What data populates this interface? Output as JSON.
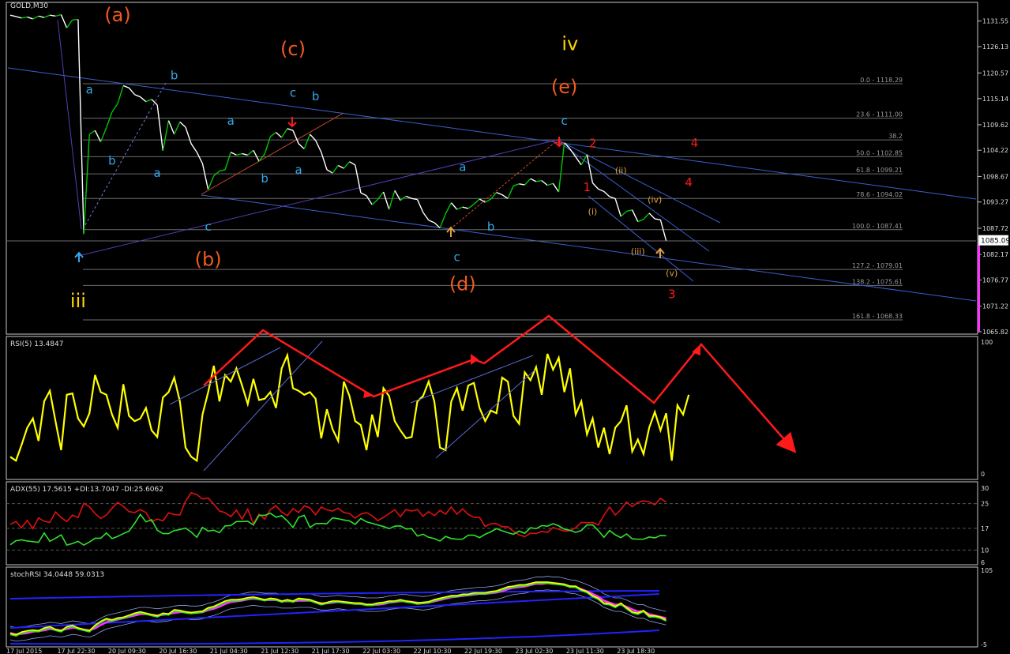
{
  "symbol": "GOLD,M30",
  "colors": {
    "background": "#000000",
    "frame": "#c8c8c8",
    "price_up": "#00c800",
    "price_down": "#ffffff",
    "trendline": "#3a5ecf",
    "fib_line": "#6b6b6b",
    "wave_blue": "#35a7e8",
    "wave_orange": "#f05a1e",
    "wave_yellow": "#ffd400",
    "wave_red": "#ff1a1a",
    "wave_tan": "#e0a040",
    "rsi_line": "#ffff00",
    "adx_red": "#e01010",
    "adx_green": "#30e030",
    "projection": "#ff1a1a"
  },
  "price_axis": {
    "min": 1065.82,
    "max": 1134.5,
    "ticks": [
      "1131.55",
      "1126.13",
      "1120.57",
      "1115.14",
      "1109.62",
      "1104.22",
      "1098.67",
      "1093.27",
      "1087.72",
      "1082.17",
      "1076.77",
      "1071.22",
      "1065.82"
    ],
    "current_price": "1085.09",
    "current_price_value": 1085.09
  },
  "fib_levels": [
    {
      "label": "0.0 - 1118.29",
      "price": 1118.29
    },
    {
      "label": "23.6 - 1111.00",
      "price": 1111.0
    },
    {
      "label": "38.2",
      "price": 1106.4
    },
    {
      "label": "50.0 - 1102.85",
      "price": 1102.85
    },
    {
      "label": "61.8 - 1099.21",
      "price": 1099.21
    },
    {
      "label": "78.6 - 1094.02",
      "price": 1094.02
    },
    {
      "label": "100.0 - 1087.41",
      "price": 1087.41
    },
    {
      "label": "127.2 - 1079.01",
      "price": 1079.01
    },
    {
      "label": "138.2 - 1075.61",
      "price": 1075.61
    },
    {
      "label": "161.8 - 1068.33",
      "price": 1068.33
    }
  ],
  "wave_labels": [
    {
      "text": "(a)",
      "color": "wave_orange",
      "size": "large",
      "bar": 19,
      "price": 1131.5
    },
    {
      "text": "a",
      "color": "wave_blue",
      "size": "small",
      "bar": 14,
      "price": 1116.2
    },
    {
      "text": "b",
      "color": "wave_blue",
      "size": "small",
      "bar": 29,
      "price": 1119.2
    },
    {
      "text": "b",
      "color": "wave_blue",
      "size": "small",
      "bar": 18,
      "price": 1101.2
    },
    {
      "text": "a",
      "color": "wave_blue",
      "size": "small",
      "bar": 26,
      "price": 1098.6
    },
    {
      "text": "(c)",
      "color": "wave_orange",
      "size": "large",
      "bar": 50,
      "price": 1124.3
    },
    {
      "text": "c",
      "color": "wave_blue",
      "size": "small",
      "bar": 50,
      "price": 1115.5
    },
    {
      "text": "b",
      "color": "wave_blue",
      "size": "small",
      "bar": 54,
      "price": 1114.8
    },
    {
      "text": "a",
      "color": "wave_blue",
      "size": "small",
      "bar": 39,
      "price": 1109.6
    },
    {
      "text": "a",
      "color": "wave_blue",
      "size": "small",
      "bar": 51,
      "price": 1099.2
    },
    {
      "text": "b",
      "color": "wave_blue",
      "size": "small",
      "bar": 45,
      "price": 1097.4
    },
    {
      "text": "c",
      "color": "wave_blue",
      "size": "small",
      "bar": 35,
      "price": 1087.2
    },
    {
      "text": "(b)",
      "color": "wave_orange",
      "size": "large",
      "bar": 35,
      "price": 1079.8
    },
    {
      "text": "iii",
      "color": "wave_yellow",
      "size": "large",
      "bar": 12,
      "price": 1071.0
    },
    {
      "text": "a",
      "color": "wave_blue",
      "size": "small",
      "bar": 80,
      "price": 1099.8
    },
    {
      "text": "b",
      "color": "wave_blue",
      "size": "small",
      "bar": 85,
      "price": 1087.2
    },
    {
      "text": "c",
      "color": "wave_blue",
      "size": "small",
      "bar": 79,
      "price": 1080.8
    },
    {
      "text": "(d)",
      "color": "wave_orange",
      "size": "large",
      "bar": 80,
      "price": 1074.6
    },
    {
      "text": "iv",
      "color": "wave_yellow",
      "size": "large",
      "bar": 99,
      "price": 1125.4
    },
    {
      "text": "(e)",
      "color": "wave_orange",
      "size": "large",
      "bar": 98,
      "price": 1116.3
    },
    {
      "text": "c",
      "color": "wave_blue",
      "size": "small",
      "bar": 98,
      "price": 1109.6
    },
    {
      "text": "2",
      "color": "wave_red",
      "size": "small",
      "bar": 103,
      "price": 1104.8
    },
    {
      "text": "1",
      "color": "wave_red",
      "size": "small",
      "bar": 102,
      "price": 1095.6
    },
    {
      "text": "(ii)",
      "color": "wave_tan",
      "size": "tiny",
      "bar": 108,
      "price": 1099.3
    },
    {
      "text": "(i)",
      "color": "wave_tan",
      "size": "tiny",
      "bar": 103,
      "price": 1090.6
    },
    {
      "text": "(iv)",
      "color": "wave_tan",
      "size": "tiny",
      "bar": 114,
      "price": 1093.1
    },
    {
      "text": "(iii)",
      "color": "wave_tan",
      "size": "tiny",
      "bar": 111,
      "price": 1082.2
    },
    {
      "text": "(v)",
      "color": "wave_tan",
      "size": "tiny",
      "bar": 117,
      "price": 1077.6
    },
    {
      "text": "3",
      "color": "wave_red",
      "size": "small",
      "bar": 117,
      "price": 1072.9
    },
    {
      "text": "4",
      "color": "wave_red",
      "size": "small",
      "bar": 121,
      "price": 1104.9
    },
    {
      "text": "4",
      "color": "wave_red",
      "size": "small",
      "bar": 120,
      "price": 1096.6
    }
  ],
  "rsi": {
    "label": "RSI(5) 13.4847",
    "ticks": [
      "100",
      "0"
    ],
    "min": 0,
    "max": 100
  },
  "adx": {
    "label": "ADX(55) 17.5615 +DI:13.7047 -DI:25.6062",
    "ticks": [
      "30",
      "25",
      "17",
      "10",
      "6"
    ],
    "levels": [
      25,
      17,
      10
    ],
    "min": 6,
    "max": 30
  },
  "stochrsi": {
    "label": "stochRSI 34.0448 59.0313",
    "ticks": [
      "105",
      "-5"
    ],
    "min": -5,
    "max": 105
  },
  "time_axis": {
    "labels": [
      "17 Jul 2015",
      "17 Jul 22:30",
      "20 Jul 09:30",
      "20 Jul 16:30",
      "21 Jul 04:30",
      "21 Jul 12:30",
      "21 Jul 17:30",
      "22 Jul 03:30",
      "22 Jul 10:30",
      "22 Jul 19:30",
      "23 Jul 02:30",
      "23 Jul 11:30",
      "23 Jul 18:30"
    ],
    "label_bars": [
      0,
      9,
      18,
      27,
      36,
      45,
      54,
      63,
      72,
      81,
      90,
      99,
      108
    ]
  },
  "chart_data": {
    "type": "line",
    "title": "GOLD,M30",
    "x": [
      0,
      1,
      2,
      3,
      4,
      5,
      6,
      7,
      8,
      9,
      10,
      11,
      12,
      13,
      14,
      15,
      16,
      17,
      18,
      19,
      20,
      21,
      22,
      23,
      24,
      25,
      26,
      27,
      28,
      29,
      30,
      31,
      32,
      33,
      34,
      35,
      36,
      37,
      38,
      39,
      40,
      41,
      42,
      43,
      44,
      45,
      46,
      47,
      48,
      49,
      50,
      51,
      52,
      53,
      54,
      55,
      56,
      57,
      58,
      59,
      60,
      61,
      62,
      63,
      64,
      65,
      66,
      67,
      68,
      69,
      70,
      71,
      72,
      73,
      74,
      75,
      76,
      77,
      78,
      79,
      80,
      81,
      82,
      83,
      84,
      85,
      86,
      87,
      88,
      89,
      90,
      91,
      92,
      93,
      94,
      95,
      96,
      97,
      98,
      99,
      100,
      101,
      102,
      103,
      104,
      105,
      106,
      107,
      108,
      109,
      110,
      111,
      112,
      113,
      114,
      115,
      116
    ],
    "series": [
      {
        "values": [
          1132.8,
          1132.5,
          1132.2,
          1132.4,
          1132.0,
          1132.6,
          1132.3,
          1132.8,
          1132.6,
          1132.9,
          1130.1,
          1131.8,
          1131.9,
          1086.5,
          1107.6,
          1108.4,
          1106.0,
          1109.0,
          1112.3,
          1114.1,
          1117.9,
          1117.4,
          1116.0,
          1115.5,
          1114.5,
          1115.0,
          1113.8,
          1104.1,
          1110.5,
          1107.6,
          1110.2,
          1109.1,
          1105.6,
          1103.8,
          1101.4,
          1095.9,
          1098.8,
          1099.8,
          1100.1,
          1103.8,
          1103.2,
          1103.5,
          1103.2,
          1104.2,
          1101.9,
          1103.4,
          1107.1,
          1108.0,
          1106.9,
          1108.8,
          1108.4,
          1105.6,
          1104.5,
          1107.6,
          1106.3,
          1103.8,
          1100.1,
          1099.4,
          1101.0,
          1100.4,
          1101.8,
          1101.1,
          1095.2,
          1094.6,
          1092.7,
          1093.8,
          1095.4,
          1091.7,
          1095.7,
          1093.6,
          1094.5,
          1094.0,
          1093.8,
          1091.1,
          1089.4,
          1088.9,
          1087.8,
          1090.8,
          1093.1,
          1091.7,
          1092.2,
          1091.9,
          1092.8,
          1093.9,
          1093.2,
          1093.9,
          1095.3,
          1094.8,
          1094.0,
          1096.7,
          1097.1,
          1096.9,
          1098.2,
          1097.6,
          1097.8,
          1096.8,
          1097.2,
          1095.4,
          1105.8,
          1104.5,
          1102.8,
          1101.1,
          1103.3,
          1097.3,
          1096.0,
          1095.5,
          1094.4,
          1094.0,
          1090.2,
          1091.3,
          1091.6,
          1089.1,
          1089.6,
          1090.9,
          1089.7,
          1089.5,
          1085.1
        ]
      }
    ],
    "rsi_values": [
      13,
      10,
      22,
      35,
      42,
      25,
      55,
      63,
      40,
      18,
      60,
      61,
      42,
      36,
      46,
      75,
      62,
      60,
      45,
      35,
      68,
      44,
      40,
      42,
      50,
      33,
      28,
      58,
      62,
      73,
      55,
      20,
      13,
      10,
      45,
      62,
      82,
      55,
      75,
      70,
      80,
      67,
      53,
      72,
      56,
      57,
      62,
      50,
      80,
      90,
      65,
      63,
      60,
      62,
      57,
      27,
      49,
      34,
      25,
      70,
      59,
      40,
      37,
      18,
      45,
      28,
      65,
      59,
      40,
      33,
      27,
      28,
      55,
      59,
      70,
      55,
      20,
      18,
      55,
      65,
      48,
      67,
      69,
      50,
      40,
      48,
      46,
      73,
      70,
      44,
      38,
      77,
      71,
      81,
      60,
      91,
      79,
      88,
      62,
      80,
      45,
      55,
      30,
      42,
      20,
      35,
      15,
      35,
      40,
      52,
      17,
      26,
      15,
      35,
      47,
      33,
      46,
      10,
      52,
      45,
      60
    ],
    "adx_values": [
      18.3,
      19.2,
      17.2,
      19.6,
      16.9,
      20.4,
      19.3,
      18.9,
      22.3,
      20.5,
      19.2,
      21.3,
      20.5,
      25.1,
      24.0,
      21.8,
      20.2,
      21.3,
      23.5,
      25.4,
      24.1,
      22.4,
      22.1,
      23.1,
      22.1,
      19.1,
      20.0,
      19.4,
      22.0,
      21.5,
      21.3,
      25.8,
      28.5,
      27.9,
      26.5,
      26.8,
      24.8,
      22.6,
      22.1,
      20.8,
      22.9,
      20.0,
      23.2,
      18.5,
      21.6,
      20.0,
      23.1,
      24.3,
      22.3,
      21.1,
      23.4,
      22.1,
      24.3,
      23.6,
      21.4,
      23.9,
      23.0,
      22.6,
      23.5,
      22.1,
      21.8,
      20.3,
      21.6,
      22.1,
      21.1,
      19.5,
      20.5,
      21.8,
      23.0,
      20.8,
      23.1,
      22.6,
      23.1,
      20.9,
      22.4,
      21.1,
      22.8,
      21.6,
      23.9,
      21.6,
      23.3,
      21.5,
      20.6,
      20.5,
      17.6,
      18.5,
      18.5,
      17.5,
      17.5,
      16.0,
      14.9,
      14.3,
      15.5,
      15.3,
      16.0,
      15.7,
      17.3,
      16.7,
      16.1,
      16.2,
      17.2,
      18.9,
      18.8,
      18.9,
      18.1,
      21.2,
      23.9,
      21.3,
      23.1,
      25.5,
      24.0,
      25.4,
      25.9,
      25.6,
      24.6,
      26.7,
      25.5
    ],
    "di_values": [
      11.7,
      13.0,
      13.3,
      12.9,
      12.7,
      12.5,
      15.5,
      12.8,
      13.8,
      14.9,
      11.6,
      12.1,
      12.8,
      11.6,
      12.6,
      13.8,
      13.8,
      15.5,
      13.7,
      14.4,
      15.3,
      16.1,
      18.6,
      21.5,
      19.1,
      19.8,
      16.4,
      15.3,
      15.3,
      16.3,
      16.6,
      17.1,
      15.8,
      14.1,
      17.3,
      16.1,
      16.4,
      15.6,
      17.8,
      17.9,
      19.2,
      19.2,
      19.3,
      18.1,
      21.2,
      21.2,
      21.9,
      20.6,
      21.1,
      19.4,
      17.3,
      20.6,
      21.2,
      17.3,
      18.5,
      18.6,
      18.5,
      20.4,
      20.1,
      19.7,
      19.4,
      18.3,
      20.2,
      19.1,
      18.6,
      18.1,
      17.6,
      16.9,
      17.7,
      17.8,
      16.8,
      16.9,
      14.5,
      15.1,
      14.1,
      13.7,
      12.9,
      14.4,
      13.7,
      13.5,
      13.5,
      14.8,
      14.8,
      14.0,
      15.1,
      15.9,
      16.9,
      16.2,
      15.6,
      15.1,
      16.1,
      15.4,
      17.2,
      16.9,
      17.9,
      17.7,
      18.5,
      17.8,
      16.7,
      16.4,
      15.7,
      16.3,
      18.1,
      18.1,
      16.3,
      14.1,
      16.3,
      14.9,
      14.0,
      15.2,
      13.6,
      13.5,
      13.5,
      14.2,
      13.9,
      14.7,
      14.6
    ],
    "stoch_k": [
      10,
      8,
      12,
      14,
      15,
      14,
      18,
      20,
      16,
      14,
      20,
      22,
      18,
      16,
      14,
      22,
      28,
      32,
      30,
      33,
      34,
      37,
      40,
      42,
      40,
      38,
      36,
      40,
      39,
      45,
      44,
      42,
      41,
      42,
      43,
      48,
      50,
      54,
      58,
      60,
      60,
      61,
      63,
      64,
      62,
      60,
      62,
      61,
      58,
      60,
      58,
      62,
      61,
      60,
      57,
      54,
      56,
      58,
      58,
      57,
      56,
      55,
      55,
      53,
      53,
      55,
      56,
      58,
      58,
      60,
      58,
      57,
      55,
      56,
      57,
      60,
      62,
      64,
      66,
      66,
      68,
      68,
      70,
      70,
      70,
      72,
      73,
      76,
      79,
      80,
      82,
      82,
      84,
      86,
      86,
      86,
      85,
      84,
      83,
      80,
      80,
      75,
      72,
      66,
      62,
      55,
      54,
      50,
      55,
      48,
      42,
      40,
      44,
      36,
      36,
      34,
      30
    ],
    "stoch_d": [
      12,
      10,
      11,
      12,
      14,
      15,
      16,
      18,
      17,
      16,
      18,
      20,
      19,
      17,
      16,
      19,
      24,
      28,
      30,
      32,
      34,
      36,
      38,
      40,
      40,
      39,
      38,
      39,
      40,
      42,
      43,
      43,
      42,
      42,
      43,
      46,
      48,
      51,
      55,
      58,
      59,
      60,
      62,
      63,
      62,
      61,
      61,
      61,
      59,
      59,
      59,
      60,
      60,
      60,
      58,
      56,
      56,
      57,
      58,
      57,
      56,
      56,
      55,
      54,
      54,
      54,
      55,
      57,
      58,
      59,
      59,
      58,
      57,
      56,
      57,
      59,
      61,
      63,
      65,
      66,
      67,
      68,
      69,
      70,
      70,
      71,
      72,
      74,
      77,
      79,
      80,
      81,
      83,
      85,
      85,
      86,
      85,
      85,
      83,
      81,
      80,
      77,
      74,
      70,
      66,
      60,
      57,
      54,
      54,
      51,
      47,
      44,
      44,
      40,
      38,
      36,
      34
    ]
  }
}
